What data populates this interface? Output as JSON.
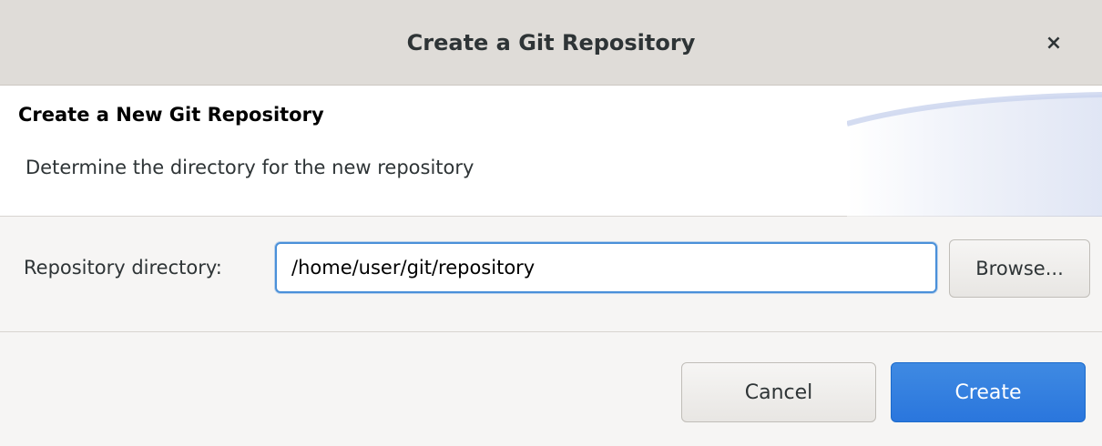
{
  "window": {
    "title": "Create a Git Repository",
    "close_icon": "close-icon",
    "close_glyph": "×"
  },
  "header": {
    "title": "Create a New Git Repository",
    "description": "Determine the directory for the new repository"
  },
  "form": {
    "directory_label": "Repository directory:",
    "directory_value": "/home/user/git/repository",
    "browse_label": "Browse..."
  },
  "buttons": {
    "cancel_label": "Cancel",
    "create_label": "Create"
  },
  "colors": {
    "accent": "#3584e4",
    "titlebar": "#dfdcd8"
  }
}
